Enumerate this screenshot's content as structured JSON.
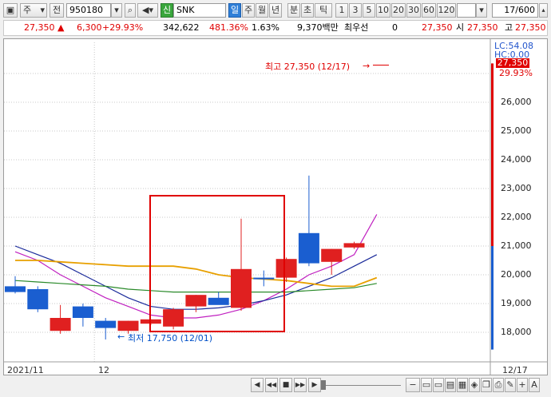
{
  "toolbar": {
    "market": "주",
    "jeon": "전",
    "code": "950180",
    "shin": "신",
    "name": "SNK",
    "periods": [
      "일",
      "주",
      "월",
      "년",
      "분",
      "초",
      "틱"
    ],
    "selected_period": "일",
    "intervals": [
      "1",
      "3",
      "5",
      "10",
      "20",
      "30",
      "60",
      "120"
    ],
    "count": "17/600"
  },
  "quote": {
    "price": "27,350",
    "change": "6,300",
    "change_pct": "+29.93%",
    "volume": "342,622",
    "volume_ratio": "481.36%",
    "turnover": "1.63%",
    "amount": "9,370백만",
    "priority_label": "최우선",
    "priority_value": "0",
    "last": "27,350",
    "open_label": "시",
    "open": "27,350",
    "high_label": "고",
    "high": "27,350"
  },
  "chart_data": {
    "type": "candlestick",
    "price_axis_ticks": [
      "26,000",
      "25,000",
      "24,000",
      "23,000",
      "22,000",
      "21,000",
      "20,000",
      "19,000",
      "18,000"
    ],
    "price_range": [
      17400,
      27700
    ],
    "x_labels": [
      {
        "label": "2021/11",
        "index": 0
      },
      {
        "label": "12",
        "index": 4
      }
    ],
    "last_date_label": "12/17",
    "current_price_tag": "27,350",
    "current_pct_tag": "29.93%",
    "lc_label": "LC:54.08",
    "hc_label": "HC:0.00",
    "high_annotation": "최고 27,350 (12/17)",
    "low_annotation": "최저 17,750 (12/01)",
    "candles": [
      {
        "o": 19600,
        "h": 19950,
        "l": 19350,
        "c": 19400
      },
      {
        "o": 19500,
        "h": 19600,
        "l": 18700,
        "c": 18800
      },
      {
        "o": 18050,
        "h": 18950,
        "l": 17950,
        "c": 18500
      },
      {
        "o": 18900,
        "h": 19000,
        "l": 18200,
        "c": 18500
      },
      {
        "o": 18400,
        "h": 18500,
        "l": 17750,
        "c": 18150
      },
      {
        "o": 18050,
        "h": 18400,
        "l": 17950,
        "c": 18400
      },
      {
        "o": 18300,
        "h": 18450,
        "l": 18250,
        "c": 18450
      },
      {
        "o": 18200,
        "h": 18850,
        "l": 18100,
        "c": 18800
      },
      {
        "o": 18900,
        "h": 19300,
        "l": 18700,
        "c": 19300
      },
      {
        "o": 19200,
        "h": 19400,
        "l": 19000,
        "c": 18950
      },
      {
        "o": 18850,
        "h": 21950,
        "l": 18750,
        "c": 20200
      },
      {
        "o": 19900,
        "h": 20150,
        "l": 19600,
        "c": 19850
      },
      {
        "o": 19900,
        "h": 20600,
        "l": 19750,
        "c": 20550
      },
      {
        "o": 21450,
        "h": 23450,
        "l": 20300,
        "c": 20400
      },
      {
        "o": 20450,
        "h": 20900,
        "l": 20000,
        "c": 20900
      },
      {
        "o": 20950,
        "h": 21150,
        "l": 20900,
        "c": 21100
      },
      {
        "o": 27350,
        "h": 27350,
        "l": 21000,
        "c": 27350
      }
    ],
    "ma_series": [
      {
        "color": "#c020c0",
        "values": [
          20800,
          20500,
          20000,
          19600,
          19200,
          18900,
          18600,
          18500,
          18500,
          18600,
          18800,
          19100,
          19500,
          20000,
          20300,
          20700,
          22100
        ]
      },
      {
        "color": "#1a2a9a",
        "values": [
          21000,
          20700,
          20400,
          20000,
          19600,
          19200,
          18900,
          18800,
          18800,
          18850,
          18950,
          19100,
          19300,
          19600,
          19900,
          20300,
          20700
        ]
      },
      {
        "color": "#e8a000",
        "values": [
          20500,
          20500,
          20450,
          20400,
          20350,
          20300,
          20300,
          20300,
          20200,
          20000,
          19900,
          19850,
          19800,
          19700,
          19600,
          19600,
          19900
        ]
      },
      {
        "color": "#2a8a2a",
        "values": [
          19800,
          19750,
          19700,
          19650,
          19600,
          19500,
          19450,
          19400,
          19400,
          19400,
          19400,
          19400,
          19400,
          19450,
          19500,
          19550,
          19700
        ]
      }
    ],
    "highlight_box_color": "#e00000"
  },
  "bottom": {
    "nav": [
      "◀",
      "◀◀",
      "■",
      "▶▶",
      "▶"
    ],
    "zoom_minus": "−",
    "zoom_plus": "+",
    "letter": "A"
  }
}
